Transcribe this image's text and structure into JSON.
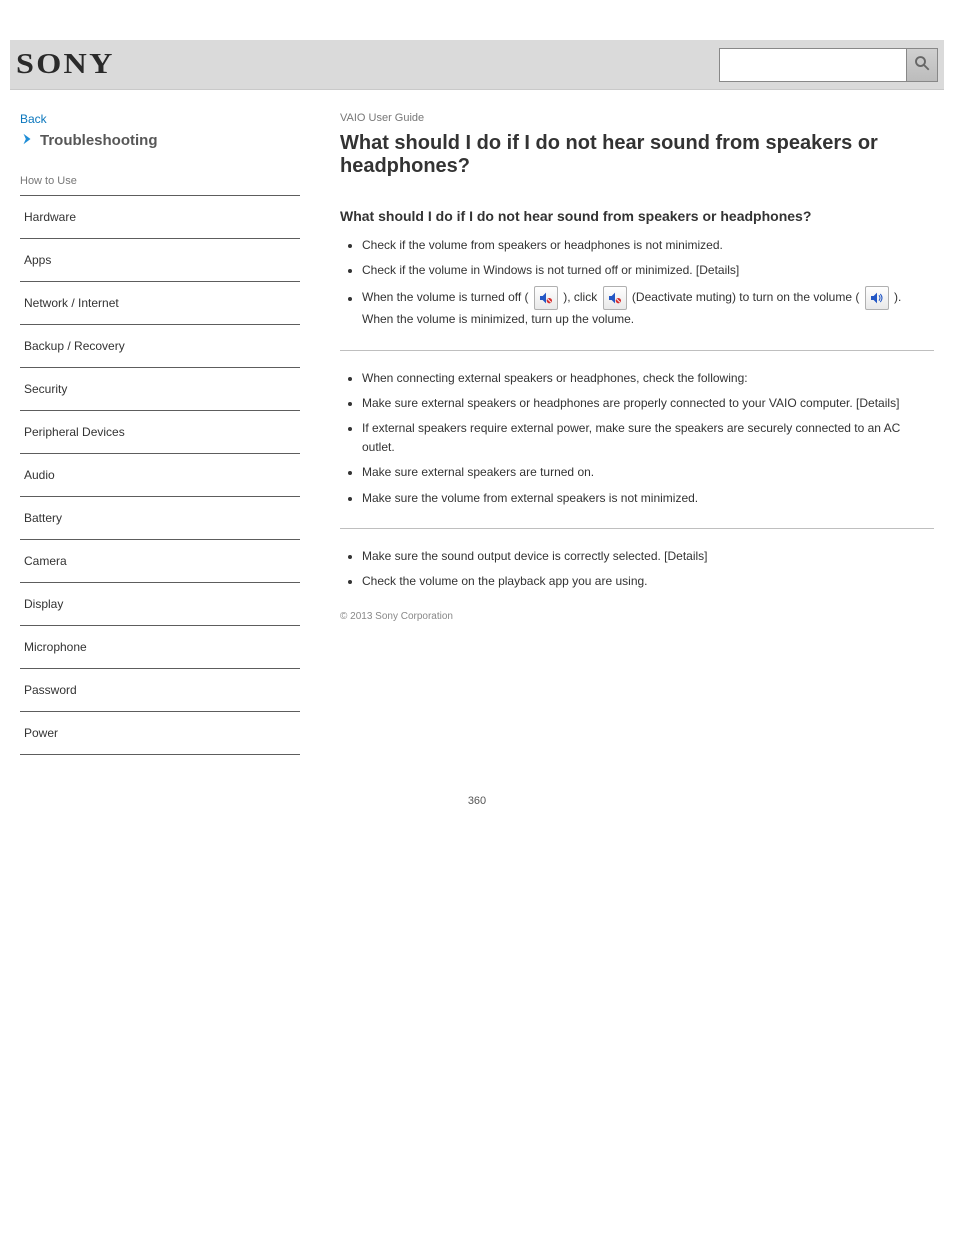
{
  "header": {
    "brand": "SONY",
    "product_line": "VAIO User Guide",
    "search_placeholder": ""
  },
  "left_sidebar": {
    "back_label": "Back",
    "top_label": "Troubleshooting",
    "how_to_use": "How to Use",
    "items": [
      "Hardware",
      "Apps",
      "Network / Internet",
      "Backup / Recovery",
      "Security",
      "Peripheral Devices",
      "Audio",
      "Battery",
      "Camera",
      "Display",
      "Microphone",
      "Password",
      "Power"
    ]
  },
  "main": {
    "breadcrumb": "VAIO User Guide",
    "title": "What should I do if I do not hear sound from speakers or headphones?",
    "sections": [
      {
        "heading": "What should I do if I do not hear sound from speakers or headphones?",
        "bullets": [
          {
            "text": "Check if the volume from speakers or headphones is not minimized."
          },
          {
            "text": "Check if the volume in Windows is not turned off or minimized. [Details]"
          },
          {
            "text_pre": "When the volume is turned off (",
            "icon": "speaker-mute-1",
            "text_mid": "), click ",
            "icon2": "speaker-mute-2",
            "text_mid2": " (Deactivate muting) to turn on the volume (",
            "icon3": "speaker-on",
            "text_post": "). When the volume is minimized, turn up the volume."
          },
          {
            "text": "When connecting external speakers or headphones, check the following:"
          },
          {
            "text": "Make sure external speakers or headphones are properly connected to your VAIO computer. [Details]"
          },
          {
            "text": "If external speakers require external power, make sure the speakers are securely connected to an AC outlet."
          },
          {
            "text": "Make sure external speakers are turned on."
          },
          {
            "text": "Make sure the volume from external speakers is not minimized."
          },
          {
            "text": "Make sure the sound output device is correctly selected. [Details]"
          },
          {
            "text": "Check the volume on the playback app you are using."
          }
        ]
      }
    ],
    "copyright": "© 2013 Sony Corporation"
  },
  "footer": {
    "page_number": "360"
  }
}
